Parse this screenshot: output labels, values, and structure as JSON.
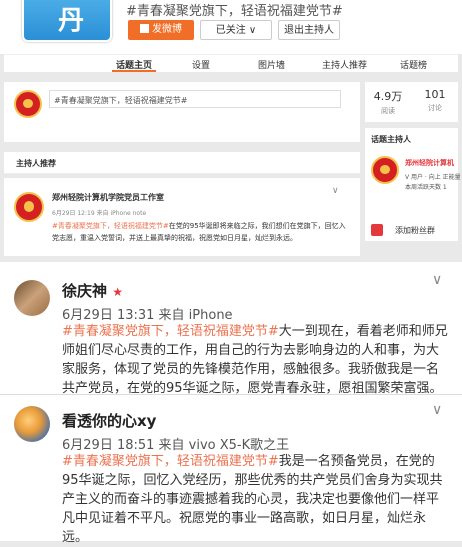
{
  "header": {
    "logo_text": "丹",
    "topic_title": "#青春凝聚党旗下，轻语祝福建党节#",
    "post_button": "发微博",
    "followed_button": "已关注 ∨",
    "exit_button": "退出主持人"
  },
  "tabs": [
    {
      "label": "话题主页",
      "active": true
    },
    {
      "label": "设置"
    },
    {
      "label": "图片墙"
    },
    {
      "label": "主持人推荐"
    },
    {
      "label": "话题榜"
    }
  ],
  "search": {
    "value": "#青春凝聚党旗下，轻语祝福建党节#"
  },
  "stats": [
    {
      "num": "4.9万",
      "label": "阅读"
    },
    {
      "num": "101",
      "label": "讨论"
    }
  ],
  "host_side": {
    "title": "话题主持人",
    "name": "郑州轻院计算机",
    "sub1": "V 用户 · 向上 正能量",
    "sub2": "本周活跃天数 1"
  },
  "fans_button": "添加粉丝群",
  "host_rec_title": "主持人推荐",
  "studio_post": {
    "name": "郑州轻院计算机学院党员工作室",
    "time": "6月29日 12:19 来自 iPhone note",
    "hashtag": "#青春凝聚党旗下，轻语祝福建党节#",
    "body": "在党的95华诞即将来临之际，我们想们在党旗下，回忆入党志愿，重温入党誓词，并送上最真挚的祝福，祝愿党如日月星，灿烂到永远。"
  },
  "posts": [
    {
      "name": "徐庆神",
      "badge": "★",
      "meta": "6月29日 13:31 来自 iPhone",
      "hashtag": "#青春凝聚党旗下，轻语祝福建党节#",
      "body": "大一到现在，看着老师和师兄师姐们尽心尽责的工作，用自己的行为去影响身边的人和事，为大家服务，体现了党员的先锋模范作用，感触很多。我骄傲我是一名共产党员，在党的95华诞之际，愿党青春永驻，愿祖国繁荣富强。"
    },
    {
      "name": "看透你的心xy",
      "meta": "6月29日 18:51 来自 vivo X5-K歌之王",
      "hashtag": "#青春凝聚党旗下，轻语祝福建党节#",
      "body": "我是一名预备党员，在党的95华诞之际，回忆入党经历，那些优秀的共产党员们舍身为实现共产主义的而奋斗的事迹震撼着我的心灵，我决定也要像他们一样平凡中见证着不平凡。祝愿党的事业一路高歌，如日月星，灿烂永远。"
    }
  ],
  "chevron": "∨"
}
